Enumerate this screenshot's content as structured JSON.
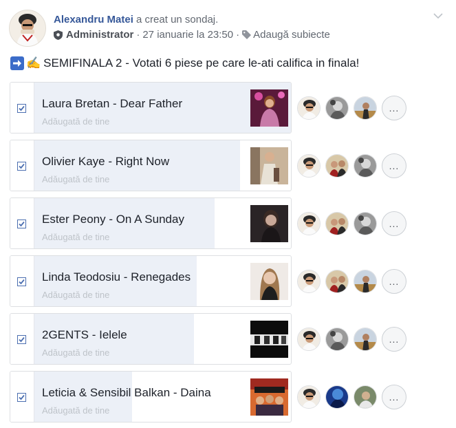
{
  "header": {
    "author": "Alexandru Matei",
    "action": "a creat un sondaj.",
    "role": "Administrator",
    "separator": "·",
    "date": "27 ianuarie la 23:50",
    "add_topics": "Adaugă subiecte"
  },
  "post": {
    "text": "SEMIFINALA 2 - Votati 6 piese pe care le-ati califica in finala!",
    "emoji": [
      "right-arrow-icon",
      "writing-hand-icon"
    ]
  },
  "options": [
    {
      "title": "Laura Bretan - Dear Father",
      "sub": "Adăugată de tine",
      "checked": true,
      "vote_share": 1.0,
      "voters": [
        "user-avatar",
        "user-avatar-bw",
        "user-avatar-field"
      ]
    },
    {
      "title": "Olivier Kaye - Right Now",
      "sub": "Adăugată de tine",
      "checked": true,
      "vote_share": 0.8,
      "voters": [
        "user-avatar",
        "user-avatar-couple",
        "user-avatar-bw"
      ]
    },
    {
      "title": "Ester Peony - On A Sunday",
      "sub": "Adăugată de tine",
      "checked": true,
      "vote_share": 0.7,
      "voters": [
        "user-avatar",
        "user-avatar-couple",
        "user-avatar-bw"
      ]
    },
    {
      "title": "Linda Teodosiu - Renegades",
      "sub": "Adăugată de tine",
      "checked": true,
      "vote_share": 0.63,
      "voters": [
        "user-avatar",
        "user-avatar-couple",
        "user-avatar-field"
      ]
    },
    {
      "title": "2GENTS - Ielele",
      "sub": "Adăugată de tine",
      "checked": true,
      "vote_share": 0.62,
      "voters": [
        "user-avatar",
        "user-avatar-bw",
        "user-avatar-field"
      ]
    },
    {
      "title": "Leticia & Sensibil Balkan - Daina",
      "sub": "Adăugată de tine",
      "checked": true,
      "vote_share": 0.38,
      "voters": [
        "user-avatar",
        "user-avatar-blue",
        "user-avatar-man"
      ]
    }
  ],
  "more_label": "...",
  "colors": {
    "link": "#365899",
    "fill": "#ecf0f7",
    "checkbox": "#4b6eb0",
    "muted": "#616770"
  }
}
